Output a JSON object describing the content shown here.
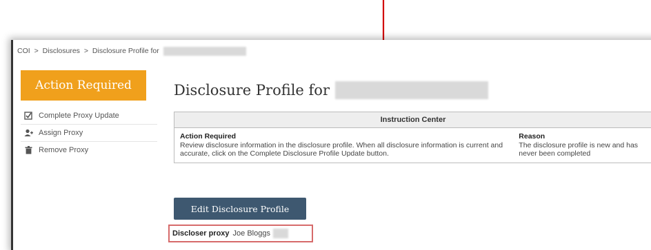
{
  "breadcrumb": [
    "COI",
    ">",
    "Disclosures",
    ">",
    "Disclosure Profile for"
  ],
  "sidebar": {
    "action_button": "Action Required",
    "items": [
      {
        "label": "Complete Proxy Update",
        "icon": "checkbox-icon"
      },
      {
        "label": "Assign Proxy",
        "icon": "user-add-icon"
      },
      {
        "label": "Remove Proxy",
        "icon": "trash-icon"
      }
    ]
  },
  "page": {
    "title": "Disclosure Profile for"
  },
  "instruction_center": {
    "header": "Instruction Center",
    "action_heading": "Action Required",
    "action_text": "Review disclosure information in the disclosure profile. When all disclosure information is current and accurate, click on the Complete Disclosure Profile Update button.",
    "reason_heading": "Reason",
    "reason_text": "The disclosure profile is new and has never been completed"
  },
  "edit_button": "Edit Disclosure Profile",
  "proxy": {
    "label": "Discloser proxy",
    "value": "Joe Bloggs"
  },
  "colors": {
    "accent": "#f0a01c",
    "button": "#3e5870",
    "annotation": "#d10000",
    "highlight_border": "#d66a6a"
  }
}
